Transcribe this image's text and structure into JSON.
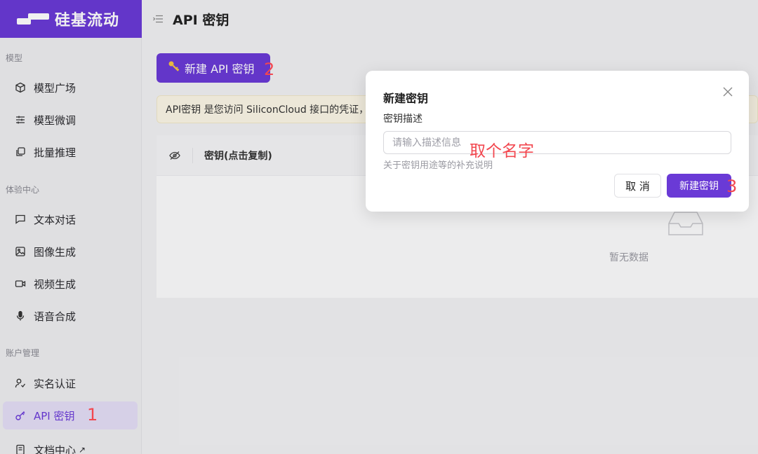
{
  "brand": {
    "name": "硅基流动",
    "color": "#6a3ad6"
  },
  "header": {
    "title": "API 密钥",
    "menu_icon": "menu-collapse-icon"
  },
  "sidebar": {
    "sections": [
      {
        "label": "模型"
      },
      {
        "label": "体验中心"
      },
      {
        "label": "账户管理"
      }
    ],
    "items": [
      {
        "label": "模型广场",
        "icon": "cube-icon"
      },
      {
        "label": "模型微调",
        "icon": "sliders-icon"
      },
      {
        "label": "批量推理",
        "icon": "stack-icon"
      },
      {
        "label": "文本对话",
        "icon": "chat-icon"
      },
      {
        "label": "图像生成",
        "icon": "image-icon"
      },
      {
        "label": "视频生成",
        "icon": "video-icon"
      },
      {
        "label": "语音合成",
        "icon": "mic-icon"
      },
      {
        "label": "实名认证",
        "icon": "user-check-icon"
      },
      {
        "label": "API 密钥",
        "icon": "key-icon",
        "active": true
      },
      {
        "label": "文档中心",
        "icon": "doc-icon",
        "external": "↗"
      }
    ]
  },
  "main": {
    "create_button": "新建 API 密钥",
    "banner_text": "API密钥 是您访问 SiliconCloud 接口的凭证，",
    "table": {
      "column_key": "密钥(点击复制)",
      "empty_text": "暂无数据"
    }
  },
  "modal": {
    "title": "新建密钥",
    "field_label": "密钥描述",
    "input_placeholder": "请输入描述信息",
    "input_value": "",
    "help_text": "关于密钥用途等的补充说明",
    "cancel_label": "取 消",
    "confirm_label": "新建密钥"
  },
  "annotations": {
    "step1": "1",
    "step2": "2",
    "step3": "3",
    "name_hint": "取个名字",
    "color": "#f2474f"
  }
}
